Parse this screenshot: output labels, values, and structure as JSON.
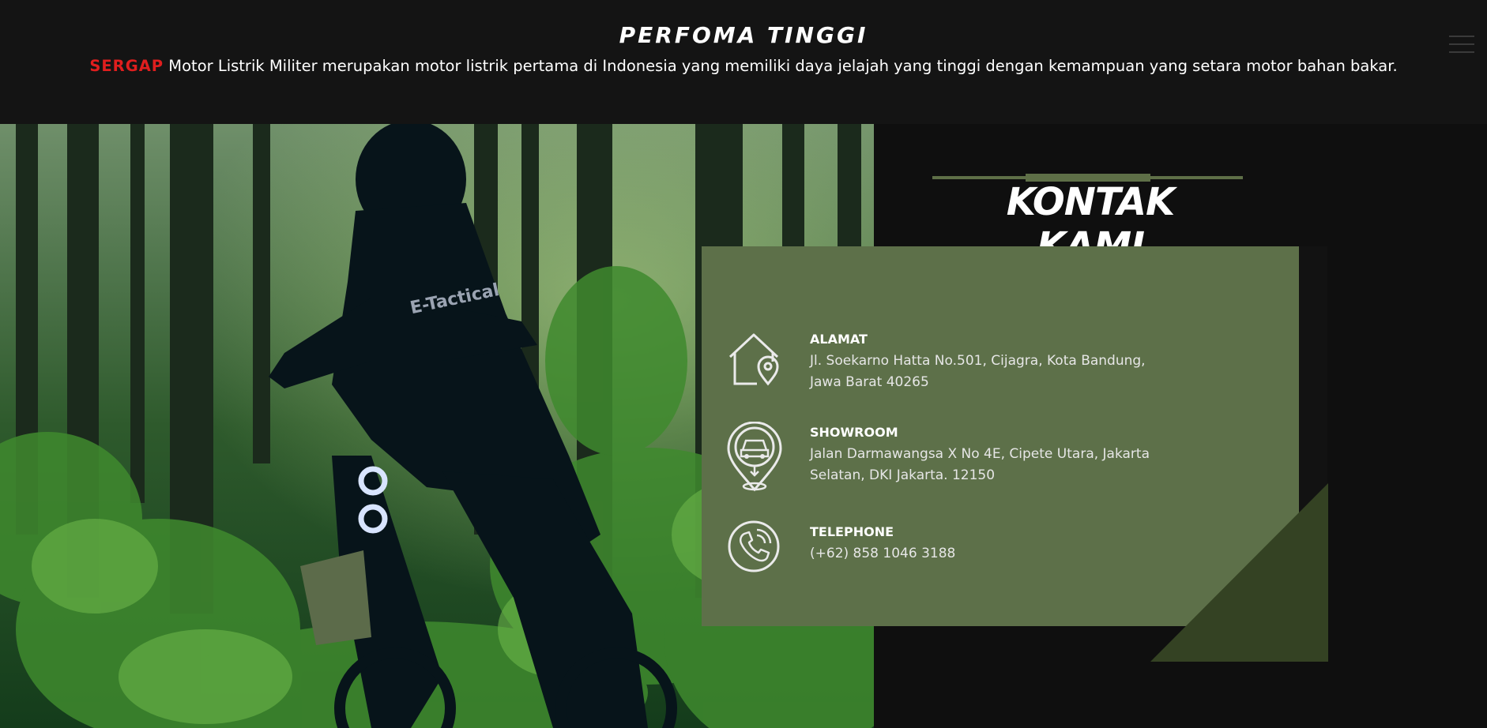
{
  "header": {
    "title": "PERFOMA TINGGI",
    "brand": "SERGAP",
    "description": " Motor Listrik Militer merupakan motor listrik pertama di Indonesia yang memiliki daya jelajah yang tinggi dengan kemampuan yang setara motor bahan bakar."
  },
  "contact": {
    "heading": "KONTAK KAMI",
    "items": [
      {
        "title": "ALAMAT",
        "line1": "Jl. Soekarno Hatta No.501, Cijagra, Kota Bandung,",
        "line2": "Jawa Barat 40265",
        "icon": "home-location-icon"
      },
      {
        "title": "SHOWROOM",
        "line1": "Jalan Darmawangsa X No 4E, Cipete Utara, Jakarta",
        "line2": "Selatan, DKI Jakarta. 12150",
        "icon": "car-pin-icon"
      },
      {
        "title": "TELEPHONE",
        "line1": "(+62) 858 1046 3188",
        "icon": "phone-icon"
      }
    ]
  },
  "photo": {
    "jersey_text": "E-Tactical"
  },
  "colors": {
    "brand_red": "#e01e1e",
    "card_green": "#5d7049",
    "dark_green": "#344223",
    "background": "#0f0f0f"
  }
}
